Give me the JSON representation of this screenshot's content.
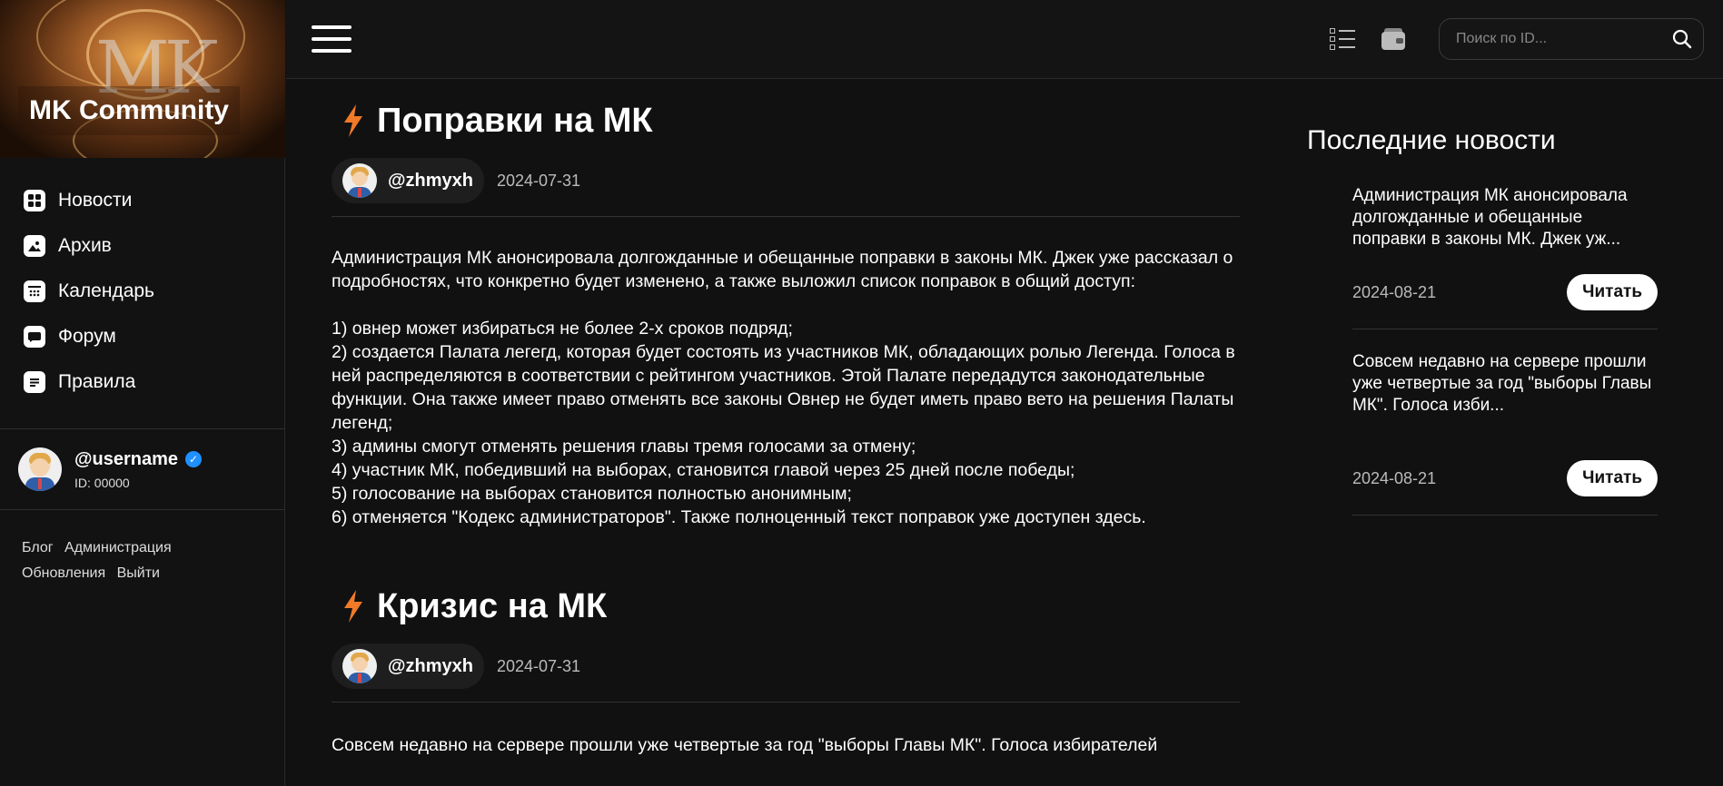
{
  "sidebar": {
    "banner_title": "MK Community",
    "banner_mark": "MK",
    "nav": [
      {
        "label": "Новости",
        "icon": "grid-icon"
      },
      {
        "label": "Архив",
        "icon": "image-icon"
      },
      {
        "label": "Календарь",
        "icon": "calendar-icon"
      },
      {
        "label": "Форум",
        "icon": "chat-icon"
      },
      {
        "label": "Правила",
        "icon": "document-icon"
      }
    ],
    "profile": {
      "username": "@username",
      "id": "ID: 00000"
    },
    "links": [
      "Блог",
      "Администрация",
      "Обновления",
      "Выйти"
    ]
  },
  "topbar": {
    "search_placeholder": "Поиск по ID..."
  },
  "articles": [
    {
      "title": "Поправки на МК",
      "author": "@zhmyxh",
      "date": "2024-07-31",
      "paragraphs": [
        "Администрация МК анонсировала долгожданные и обещанные поправки в законы МК. Джек уже рассказал о подробностях, что конкретно будет изменено, а также выложил список поправок в общий доступ:",
        "1) овнер может избираться не более 2-х сроков подряд;\n2) создается Палата легегд, которая будет состоять из участников МК, обладающих ролью Легенда. Голоса в ней распределяются в соответствии с рейтингом участников. Этой Палате передадутся законодательные функции. Она также имеет право отменять все законы Овнер не будет иметь право вето на решения Палаты легенд;\n3) админы смогут отменять решения главы тремя голосами за отмену;\n4) участник МК, победивший на выборах, становится главой через 25 дней после победы;\n5) голосование на выборах становится полностью анонимным;\n6) отменяется \"Кодекс администраторов\". Также полноценный текст поправок уже доступен здесь."
      ]
    },
    {
      "title": "Кризис на МК",
      "author": "@zhmyxh",
      "date": "2024-07-31",
      "paragraphs": [
        "Совсем недавно на сервере прошли уже четвертые за год \"выборы Главы МК\". Голоса избирателей"
      ]
    }
  ],
  "news": {
    "heading": "Последние новости",
    "items": [
      {
        "text": "Администрация МК анонсировала долгожданные и обещанные поправки в законы МК. Джек уж...",
        "date": "2024-08-21",
        "button": "Читать"
      },
      {
        "text": "Совсем недавно на сервере прошли уже четвертые за год \"выборы Главы МК\". Голоса изби...",
        "date": "2024-08-21",
        "button": "Читать"
      }
    ]
  },
  "colors": {
    "background": "#111111",
    "accent_bolt": "#f07a28",
    "verified": "#1e90ff"
  }
}
